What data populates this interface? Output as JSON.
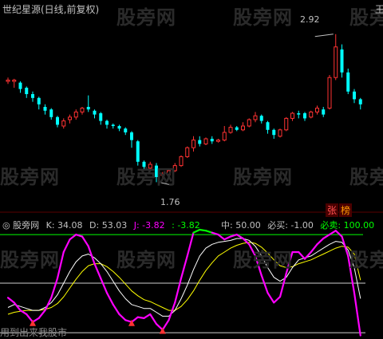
{
  "main_panel": {
    "title": "世纪星源(日线,前复权)",
    "high_label": "2.92",
    "low_label": "1.76",
    "badge_zhang": "张",
    "badge_bang": "榜",
    "corner_glyph": "王"
  },
  "indicator_panel": {
    "name": "股旁网",
    "k_label": "K: 34.08",
    "d_label": "D: 53.03",
    "j_label": "J: -3.82",
    "j2_label": ": -3.82",
    "zhong_label": "中: 50.00",
    "bimai_label": "必买: -1.00",
    "bimai2_label": "必卖: 100.00",
    "bottom_text": "用到出来我股市"
  },
  "watermark": "股旁网",
  "colors": {
    "background": "#000000",
    "up": "#ff3232",
    "down": "#00ffff",
    "j_line": "#ff00ff",
    "k_line": "#ffffff",
    "d_line": "#ffff00",
    "overbought": "#00ff00",
    "title_text": "#c0c0c0",
    "label_yellow": "#ffff00",
    "label_pink": "#ff00ff",
    "label_green": "#00ff00"
  },
  "chart_data": {
    "type": "candlestick",
    "title": "世纪星源(日线,前复权)",
    "price_range": [
      1.6,
      3.1
    ],
    "annotated_high": 2.92,
    "annotated_low": 1.76,
    "candles": [
      [
        2.55,
        2.56,
        2.53,
        2.58
      ],
      [
        2.55,
        2.56,
        2.5,
        2.57
      ],
      [
        2.54,
        2.49,
        2.46,
        2.55
      ],
      [
        2.5,
        2.45,
        2.42,
        2.51
      ],
      [
        2.45,
        2.42,
        2.39,
        2.47
      ],
      [
        2.42,
        2.37,
        2.33,
        2.43
      ],
      [
        2.35,
        2.32,
        2.29,
        2.37
      ],
      [
        2.33,
        2.27,
        2.25,
        2.34
      ],
      [
        2.27,
        2.21,
        2.19,
        2.28
      ],
      [
        2.2,
        2.24,
        2.18,
        2.26
      ],
      [
        2.25,
        2.27,
        2.22,
        2.29
      ],
      [
        2.27,
        2.31,
        2.25,
        2.33
      ],
      [
        2.31,
        2.34,
        2.29,
        2.35
      ],
      [
        2.35,
        2.33,
        2.31,
        2.44
      ],
      [
        2.32,
        2.29,
        2.26,
        2.33
      ],
      [
        2.3,
        2.24,
        2.21,
        2.31
      ],
      [
        2.24,
        2.21,
        2.18,
        2.25
      ],
      [
        2.21,
        2.2,
        2.18,
        2.22
      ],
      [
        2.2,
        2.18,
        2.16,
        2.21
      ],
      [
        2.18,
        2.15,
        2.13,
        2.19
      ],
      [
        2.15,
        2.09,
        2.03,
        2.16
      ],
      [
        2.08,
        1.92,
        1.89,
        2.09
      ],
      [
        1.92,
        1.88,
        1.85,
        1.93
      ],
      [
        1.87,
        1.9,
        1.85,
        1.92
      ],
      [
        1.89,
        1.8,
        1.76,
        1.91
      ],
      [
        1.82,
        1.82,
        1.79,
        1.84
      ],
      [
        1.82,
        1.85,
        1.81,
        1.86
      ],
      [
        1.85,
        1.89,
        1.84,
        1.91
      ],
      [
        1.89,
        1.96,
        1.88,
        1.97
      ],
      [
        1.96,
        2.03,
        1.95,
        2.04
      ],
      [
        2.03,
        2.09,
        2.0,
        2.12
      ],
      [
        2.09,
        2.06,
        2.04,
        2.12
      ],
      [
        2.06,
        2.1,
        2.05,
        2.11
      ],
      [
        2.1,
        2.08,
        2.06,
        2.12
      ],
      [
        2.08,
        2.09,
        2.07,
        2.1
      ],
      [
        2.09,
        2.15,
        2.08,
        2.2
      ],
      [
        2.15,
        2.19,
        2.14,
        2.21
      ],
      [
        2.19,
        2.17,
        2.16,
        2.2
      ],
      [
        2.17,
        2.2,
        2.16,
        2.23
      ],
      [
        2.2,
        2.25,
        2.19,
        2.26
      ],
      [
        2.25,
        2.28,
        2.23,
        2.31
      ],
      [
        2.28,
        2.24,
        2.22,
        2.29
      ],
      [
        2.23,
        2.17,
        2.14,
        2.24
      ],
      [
        2.17,
        2.13,
        2.1,
        2.18
      ],
      [
        2.12,
        2.17,
        2.11,
        2.18
      ],
      [
        2.17,
        2.26,
        2.16,
        2.27
      ],
      [
        2.26,
        2.3,
        2.24,
        2.31
      ],
      [
        2.3,
        2.29,
        2.26,
        2.32
      ],
      [
        2.3,
        2.26,
        2.24,
        2.31
      ],
      [
        2.27,
        2.31,
        2.26,
        2.32
      ],
      [
        2.31,
        2.34,
        2.29,
        2.36
      ],
      [
        2.33,
        2.29,
        2.27,
        2.35
      ],
      [
        2.34,
        2.58,
        2.33,
        2.6
      ],
      [
        2.58,
        2.82,
        2.56,
        2.92
      ],
      [
        2.8,
        2.62,
        2.58,
        2.84
      ],
      [
        2.62,
        2.47,
        2.45,
        2.65
      ],
      [
        2.47,
        2.41,
        2.38,
        2.49
      ],
      [
        2.41,
        2.37,
        2.33,
        2.42
      ]
    ],
    "indicator": {
      "name": "股旁网",
      "lines": [
        "K",
        "D",
        "J"
      ],
      "levels": {
        "bimai": -1.0,
        "zhong": 50.0,
        "bimai_sell": 100.0
      },
      "last": {
        "K": 34.08,
        "D": 53.03,
        "J": -3.82
      },
      "range": [
        -5,
        105
      ],
      "J": [
        35,
        30,
        22,
        18,
        10,
        14,
        22,
        35,
        55,
        82,
        95,
        100,
        98,
        88,
        70,
        55,
        40,
        28,
        18,
        12,
        10,
        15,
        14,
        18,
        8,
        2,
        12,
        30,
        55,
        78,
        102,
        105,
        104,
        102,
        100,
        95,
        98,
        100,
        96,
        90,
        78,
        58,
        40,
        30,
        36,
        60,
        82,
        82,
        75,
        82,
        90,
        96,
        100,
        104,
        98,
        78,
        40,
        -3.82
      ],
      "K": [
        25,
        28,
        26,
        24,
        22,
        22,
        25,
        30,
        38,
        50,
        62,
        72,
        78,
        80,
        76,
        70,
        62,
        52,
        42,
        34,
        28,
        26,
        24,
        24,
        20,
        16,
        16,
        22,
        34,
        48,
        64,
        78,
        86,
        90,
        92,
        93,
        94,
        96,
        96,
        94,
        88,
        78,
        66,
        56,
        52,
        56,
        66,
        74,
        76,
        78,
        82,
        86,
        90,
        93,
        92,
        84,
        66,
        34.08
      ],
      "D": [
        18,
        20,
        21,
        22,
        22,
        22,
        23,
        25,
        29,
        36,
        45,
        54,
        62,
        68,
        70,
        70,
        67,
        62,
        56,
        49,
        42,
        37,
        33,
        31,
        28,
        25,
        22,
        22,
        26,
        33,
        42,
        53,
        63,
        71,
        78,
        82,
        86,
        89,
        91,
        92,
        91,
        87,
        81,
        74,
        68,
        66,
        67,
        70,
        72,
        74,
        77,
        80,
        83,
        86,
        88,
        87,
        80,
        53.03
      ]
    }
  }
}
